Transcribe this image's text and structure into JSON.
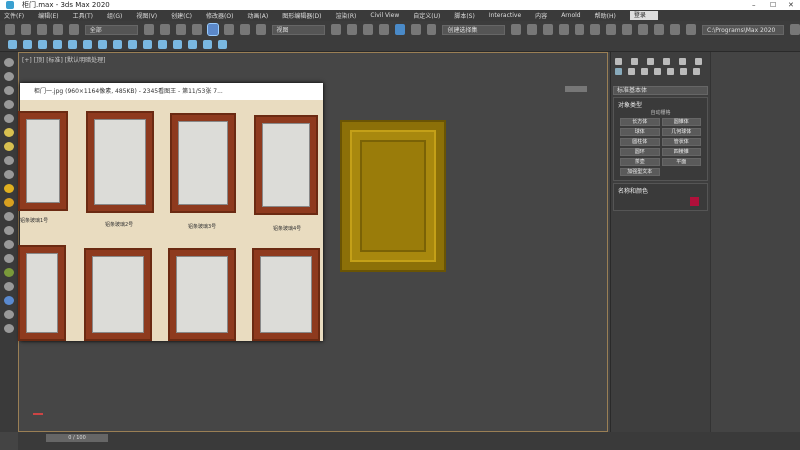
{
  "window": {
    "title": "柜门.max - 3ds Max 2020",
    "minimize": "–",
    "maximize": "☐",
    "close": "✕"
  },
  "menu": [
    "文件(F)",
    "编辑(E)",
    "工具(T)",
    "组(G)",
    "视图(V)",
    "创建(C)",
    "修改器(O)",
    "动画(A)",
    "图形编辑器(D)",
    "渲染(R)",
    "Civil View",
    "自定义(U)",
    "脚本(S)",
    "Interactive",
    "内容",
    "Arnold",
    "帮助(H)"
  ],
  "user": "登录",
  "toolbar": {
    "selection_filter": "全部",
    "named_selection": "创建选择集",
    "view_dropdown": "视图",
    "project_path": "C:\\Programs\\Max 2020"
  },
  "viewport": {
    "label": "[+] [顶] [标准] [默认明暗处理]"
  },
  "image_viewer": {
    "title": "柜门一.jpg (960×1164像素, 485KB) - 2345看图王 - 第11/53张 7...",
    "captions": [
      "铝条玻璃1号",
      "铝条玻璃2号",
      "铝条玻璃3号",
      "铝条玻璃4号"
    ]
  },
  "command_panel": {
    "category": "标准基本体",
    "object_type_header": "对象类型",
    "autogrid": "自动栅格",
    "buttons": [
      "长方体",
      "圆锥体",
      "球体",
      "几何球体",
      "圆柱体",
      "管状体",
      "圆环",
      "四棱锥",
      "茶壶",
      "平面",
      "加强型文本"
    ],
    "name_color_header": "名称和颜色",
    "object_color": "#b0103a"
  },
  "timeline": {
    "frame": "0 / 100"
  },
  "colors": {
    "door": "#a8880e",
    "accent": "#5b88c9"
  }
}
